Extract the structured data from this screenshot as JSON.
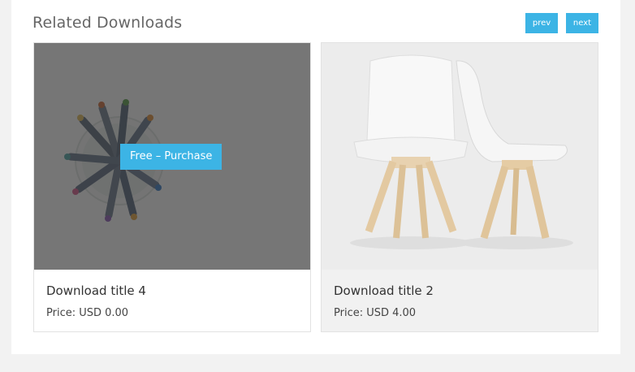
{
  "section": {
    "title": "Related Downloads",
    "prev_label": "prev",
    "next_label": "next"
  },
  "downloads": [
    {
      "title": "Download title 4",
      "price": "Price: USD 0.00",
      "action_label": "Free – Purchase",
      "image": "pencils-in-cup-photo",
      "hover_overlay": true
    },
    {
      "title": "Download title 2",
      "price": "Price: USD 4.00",
      "image": "white-chairs-photo",
      "hover_overlay": false
    }
  ],
  "colors": {
    "accent": "#3cb4e5",
    "title_text": "#666666",
    "card_border": "#e2e2e2"
  }
}
